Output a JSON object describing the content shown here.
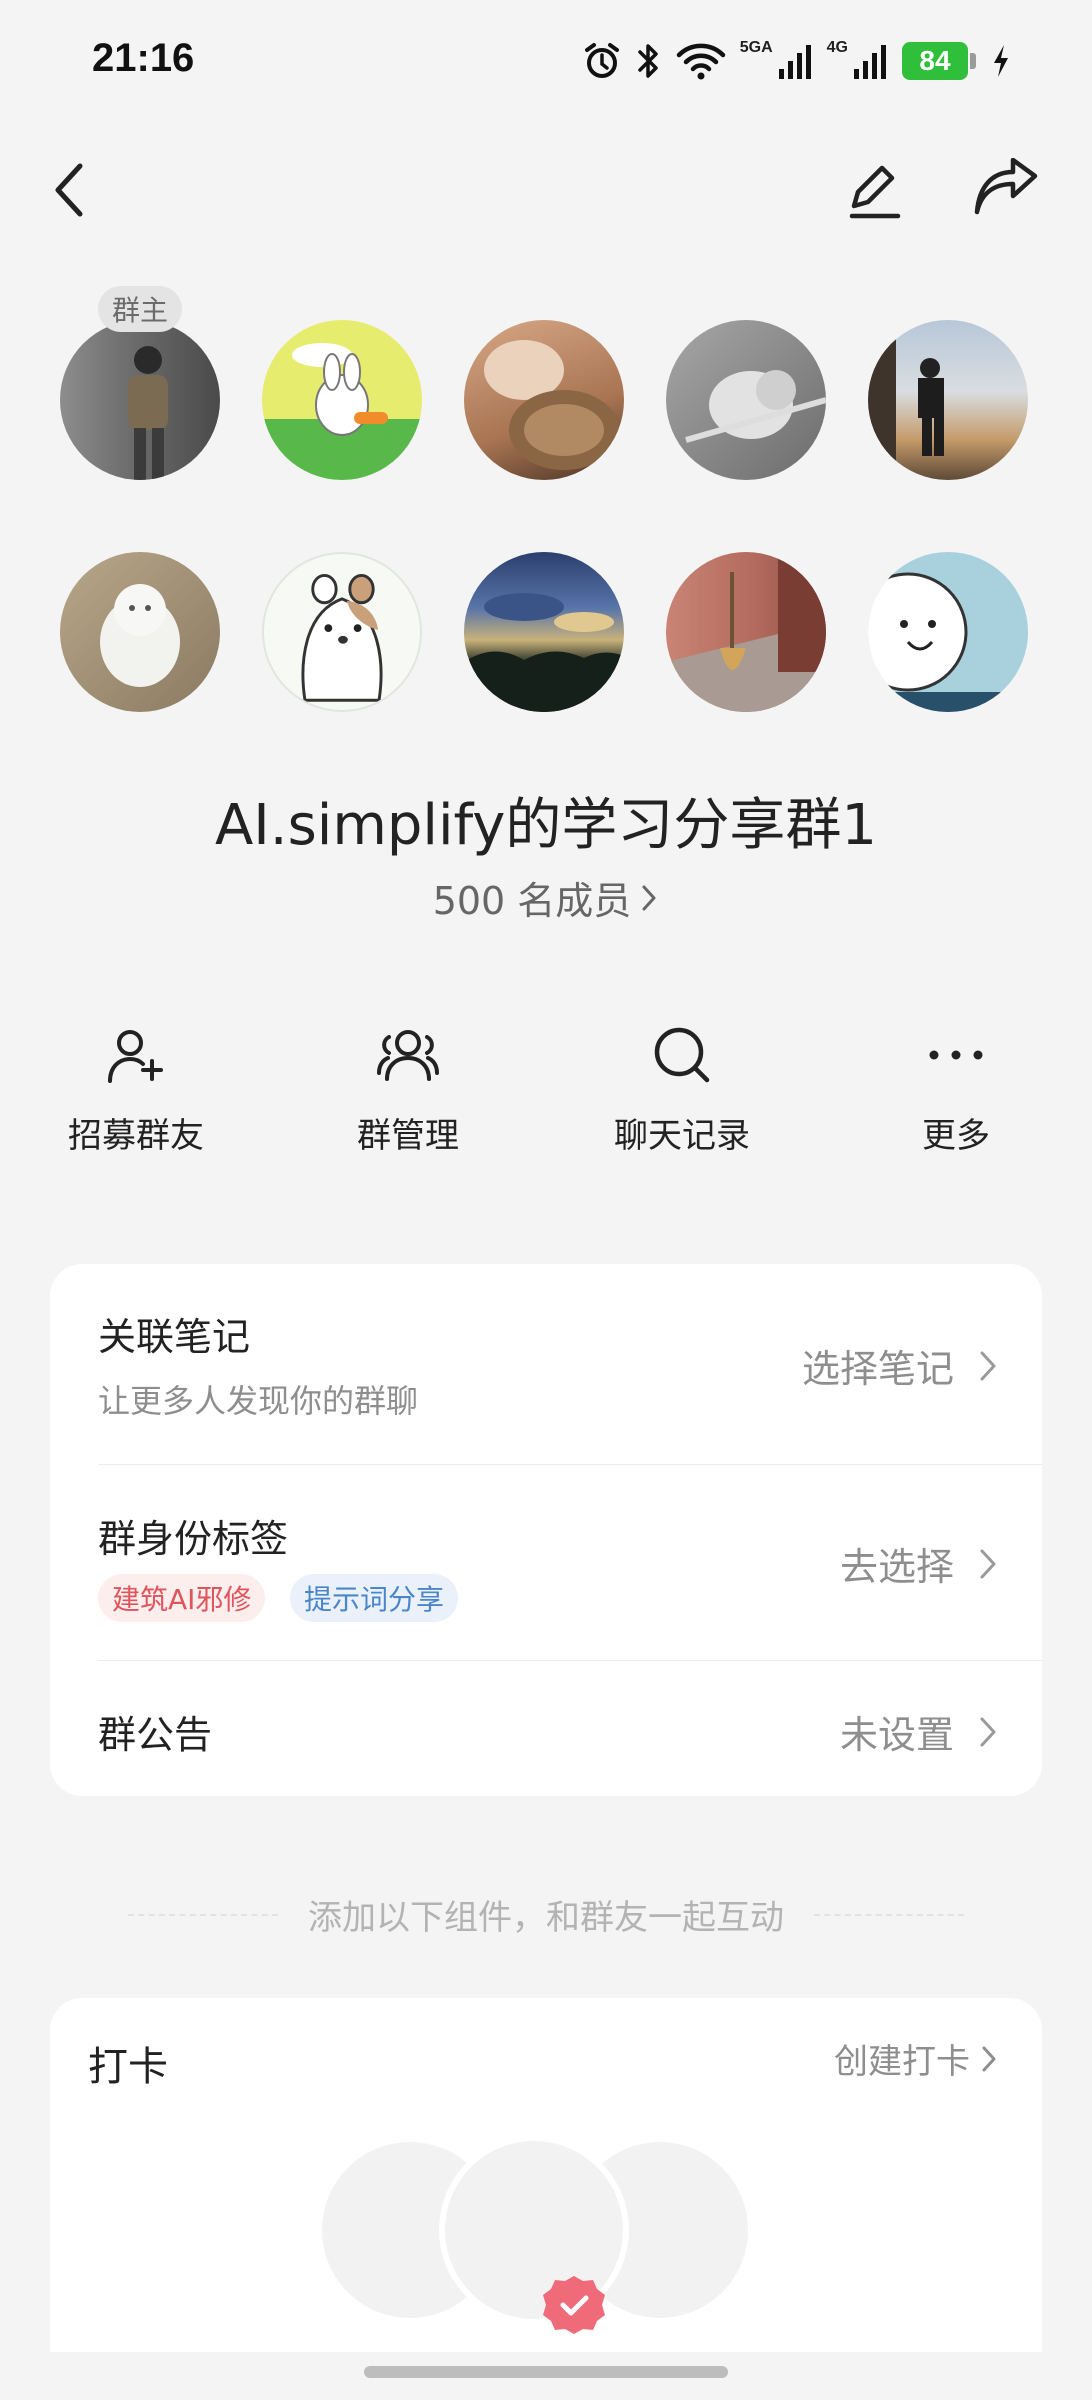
{
  "status_bar": {
    "time": "21:16",
    "network_5g": "5GA",
    "network_4g": "4G",
    "battery": "84"
  },
  "nav": {
    "back_icon": "chevron-left-icon",
    "edit_icon": "pencil-icon",
    "share_icon": "share-arrow-icon"
  },
  "members": {
    "owner_badge": "群主",
    "avatar_count": 10
  },
  "group": {
    "name": "AI.simplify的学习分享群1",
    "member_count": "500 名成员"
  },
  "actions": [
    {
      "label": "招募群友",
      "icon": "add-user-icon"
    },
    {
      "label": "群管理",
      "icon": "users-icon"
    },
    {
      "label": "聊天记录",
      "icon": "search-icon"
    },
    {
      "label": "更多",
      "icon": "more-dots-icon"
    }
  ],
  "settings": {
    "linked_notes": {
      "title": "关联笔记",
      "subtitle": "让更多人发现你的群聊",
      "action": "选择笔记"
    },
    "identity_tags": {
      "title": "群身份标签",
      "action": "去选择",
      "tags": [
        "建筑AI邪修",
        "提示词分享"
      ]
    },
    "announcement": {
      "title": "群公告",
      "action": "未设置"
    }
  },
  "widgets_hint": "添加以下组件，和群友一起互动",
  "checkin": {
    "title": "打卡",
    "action": "创建打卡"
  },
  "colors": {
    "accent_green": "#2fbf3a",
    "tag_red_text": "#e0545b",
    "tag_red_bg": "#fdeeee",
    "tag_blue_text": "#4a86c8",
    "tag_blue_bg": "#eaf1fb",
    "check_badge": "#f06b7a"
  }
}
